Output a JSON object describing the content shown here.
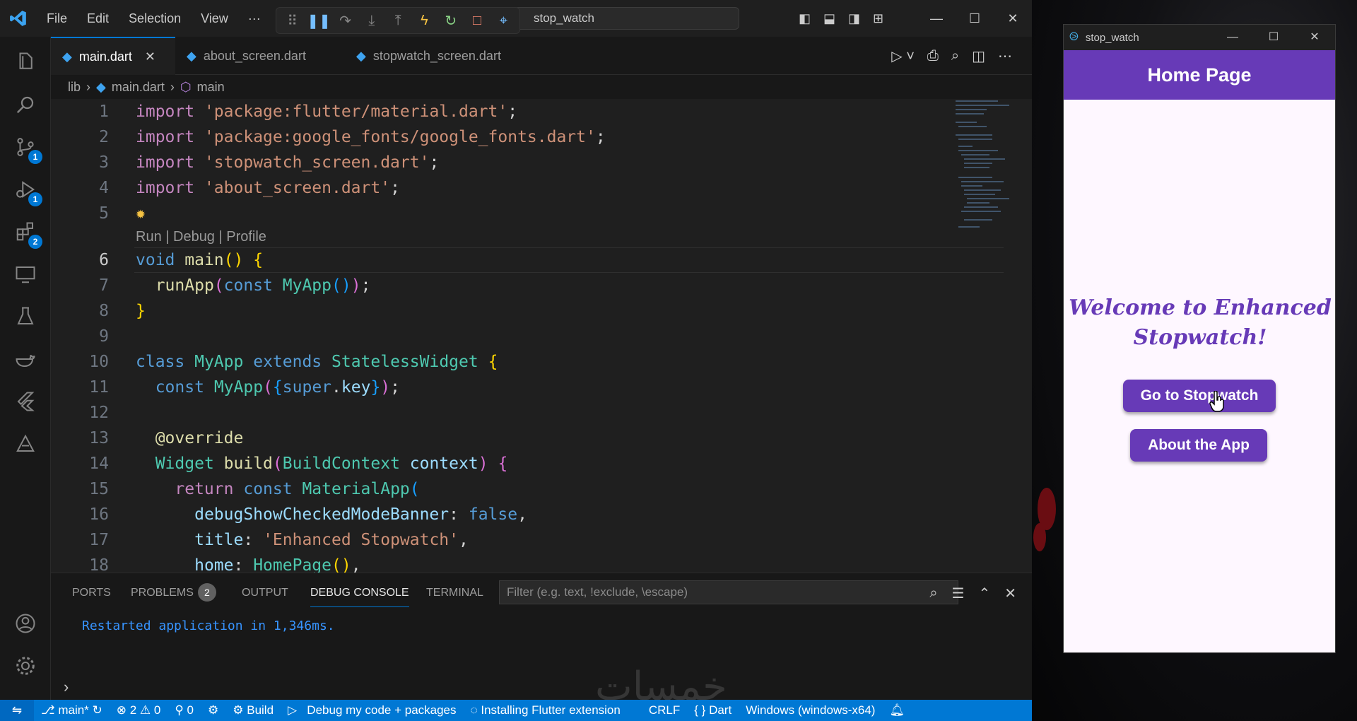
{
  "vscode": {
    "menu": [
      "File",
      "Edit",
      "Selection",
      "View",
      "···"
    ],
    "command_center": "stop_watch",
    "tabs": [
      {
        "label": "main.dart",
        "active": true
      },
      {
        "label": "about_screen.dart",
        "active": false
      },
      {
        "label": "stopwatch_screen.dart",
        "active": false
      }
    ],
    "breadcrumb": {
      "folder": "lib",
      "file": "main.dart",
      "symbol": "main"
    },
    "activity_badges": {
      "source_control": "1",
      "run_debug": "1",
      "extensions": "2"
    },
    "code_lens": "Run | Debug | Profile",
    "line_numbers": [
      "1",
      "2",
      "3",
      "4",
      "5",
      "6",
      "7",
      "8",
      "9",
      "10",
      "11",
      "12",
      "13",
      "14",
      "15",
      "16",
      "17",
      "18"
    ],
    "code": {
      "l1": {
        "kw": "import",
        "str": "'package:flutter/material.dart'",
        "end": ";"
      },
      "l2": {
        "kw": "import",
        "str": "'package:google_fonts/google_fonts.dart'",
        "end": ";"
      },
      "l3": {
        "kw": "import",
        "str": "'stopwatch_screen.dart'",
        "end": ";"
      },
      "l4": {
        "kw": "import",
        "str": "'about_screen.dart'",
        "end": ";"
      },
      "l6": {
        "t1": "void",
        "t2": "main",
        "t3": "()",
        "t4": "{"
      },
      "l7": {
        "t1": "runApp",
        "t2": "(",
        "t3": "const",
        "t4": "MyApp",
        "t5": "()",
        "t6": ")",
        "t7": ";"
      },
      "l8": {
        "t1": "}"
      },
      "l10": {
        "t1": "class",
        "t2": "MyApp",
        "t3": "extends",
        "t4": "StatelessWidget",
        "t5": "{"
      },
      "l11": {
        "t1": "const",
        "t2": "MyApp",
        "t3": "(",
        "t4": "{",
        "t5": "super",
        "t6": ".",
        "t7": "key",
        "t8": "}",
        "t9": ")",
        "t10": ";"
      },
      "l13": {
        "t1": "@override"
      },
      "l14": {
        "t1": "Widget",
        "t2": "build",
        "t3": "(",
        "t4": "BuildContext",
        "t5": "context",
        "t6": ")",
        "t7": "{"
      },
      "l15": {
        "t1": "return",
        "t2": "const",
        "t3": "MaterialApp",
        "t4": "("
      },
      "l16": {
        "t1": "debugShowCheckedModeBanner",
        "t2": ":",
        "t3": "false",
        "t4": ","
      },
      "l17": {
        "t1": "title",
        "t2": ":",
        "t3": "'Enhanced Stopwatch'",
        "t4": ","
      },
      "l18": {
        "t1": "home",
        "t2": ":",
        "t3": "HomePage",
        "t4": "()",
        "t5": ","
      }
    },
    "panel": {
      "tabs": [
        "PORTS",
        "PROBLEMS",
        "OUTPUT",
        "DEBUG CONSOLE",
        "TERMINAL"
      ],
      "problems_count": "2",
      "filter_placeholder": "Filter (e.g. text, !exclude, \\escape)",
      "output": "Restarted application in 1,346ms.",
      "watermark": "خمسات"
    },
    "status": {
      "branch": "main*",
      "errors": "2",
      "warnings": "0",
      "ports": "0",
      "build": "Build",
      "debug_config": "Debug my code + packages",
      "installing": "Installing Flutter extension",
      "eol": "CRLF",
      "language": "Dart",
      "device": "Windows (windows-x64)"
    }
  },
  "app": {
    "window_title": "stop_watch",
    "appbar_title": "Home Page",
    "welcome_line1": "Welcome to Enhanced",
    "welcome_line2": "Stopwatch!",
    "btn_stopwatch": "Go to Stopwatch",
    "btn_about": "About the App",
    "primary_color": "#673ab7"
  }
}
